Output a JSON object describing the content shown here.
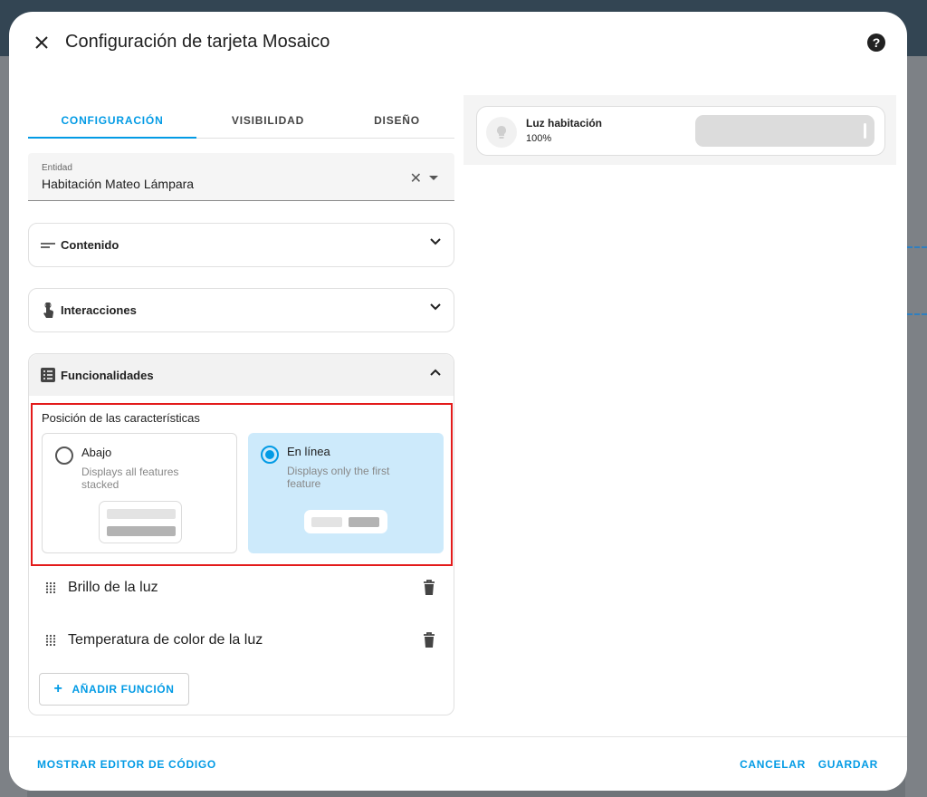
{
  "dialog": {
    "title": "Configuración de tarjeta Mosaico",
    "close_icon": "close-icon",
    "help_icon": "help-circle-icon"
  },
  "tabs": [
    {
      "label": "CONFIGURACIÓN",
      "active": true
    },
    {
      "label": "VISIBILIDAD",
      "active": false
    },
    {
      "label": "DISEÑO",
      "active": false
    }
  ],
  "entity": {
    "label": "Entidad",
    "value": "Habitación Mateo Lámpara"
  },
  "sections": {
    "content": {
      "label": "Contenido",
      "icon": "text-lines-icon"
    },
    "interactions": {
      "label": "Interacciones",
      "icon": "gesture-tap-icon"
    },
    "features": {
      "label": "Funcionalidades",
      "icon": "list-box-icon"
    }
  },
  "features_position": {
    "title": "Posición de las características",
    "options": [
      {
        "name": "Abajo",
        "description": "Displays all features stacked",
        "selected": false
      },
      {
        "name": "En línea",
        "description": "Displays only the first feature",
        "selected": true
      }
    ]
  },
  "features": [
    {
      "label": "Brillo de la luz"
    },
    {
      "label": "Temperatura de color de la luz"
    }
  ],
  "add_feature_label": "AÑADIR FUNCIÓN",
  "preview": {
    "tile_name": "Luz habitación",
    "tile_state": "100%",
    "tile_icon": "lightbulb-icon"
  },
  "footer": {
    "code_editor": "MOSTRAR EDITOR DE CÓDIGO",
    "cancel": "CANCELAR",
    "save": "GUARDAR"
  },
  "colors": {
    "accent": "#039be5",
    "highlight": "#e31b1b",
    "selected_option_bg": "#cdeafb"
  }
}
